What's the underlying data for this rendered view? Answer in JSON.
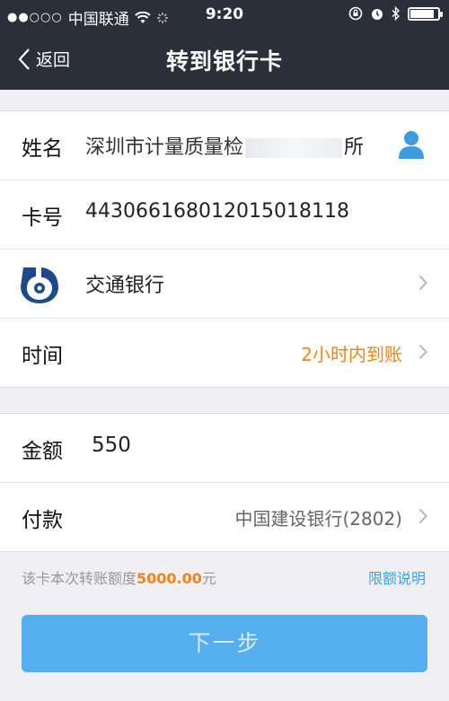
{
  "status_bar": {
    "signal": "●●○○○",
    "carrier": "中国联通",
    "time": "9:20"
  },
  "nav": {
    "back_label": "返回",
    "title": "转到银行卡"
  },
  "recipient": {
    "name_label": "姓名",
    "name_visible_start": "深圳市计量质量检",
    "name_visible_end": "所",
    "card_label": "卡号",
    "card_number": "443066168012015018118",
    "bank_name": "交通银行",
    "time_label": "时间",
    "time_value": "2小时内到账"
  },
  "payment": {
    "amount_label": "金额",
    "amount_value": "550",
    "pay_label": "付款",
    "pay_source": "中国建设银行(2802)"
  },
  "limit": {
    "prefix": "该卡本次转账额度",
    "amount": "5000.00",
    "suffix": "元",
    "link": "限额说明"
  },
  "next_button": "下一步",
  "colors": {
    "nav_bg": "#2b2f3a",
    "accent_orange": "#f08519",
    "link_blue": "#3aa3e3",
    "button_blue": "#55aef0"
  },
  "icons": {
    "back": "chevron-left-icon",
    "contact": "contact-person-icon",
    "bank": "bank-of-communications-logo",
    "chevron": "chevron-right-icon"
  }
}
